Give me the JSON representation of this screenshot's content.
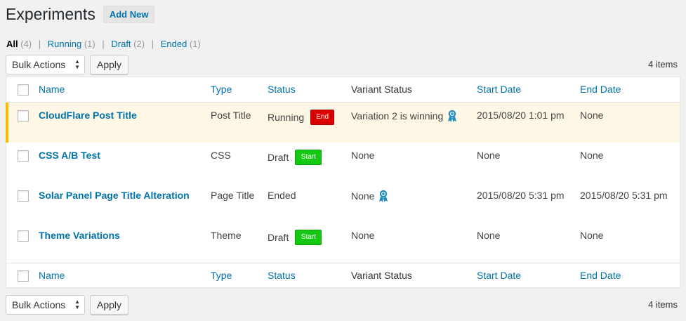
{
  "header": {
    "title": "Experiments",
    "add_new_label": "Add New"
  },
  "filters": [
    {
      "label": "All",
      "count": "(4)",
      "current": true
    },
    {
      "label": "Running",
      "count": "(1)"
    },
    {
      "label": "Draft",
      "count": "(2)"
    },
    {
      "label": "Ended",
      "count": "(1)"
    }
  ],
  "tablenav": {
    "bulk_label": "Bulk Actions",
    "apply_label": "Apply",
    "items_count": "4 items"
  },
  "columns": {
    "name": "Name",
    "type": "Type",
    "status": "Status",
    "variant_status": "Variant Status",
    "start_date": "Start Date",
    "end_date": "End Date"
  },
  "rows": [
    {
      "name": "CloudFlare Post Title",
      "type": "Post Title",
      "status": "Running",
      "action": "End",
      "variant": "Variation 2 is winning",
      "variant_icon": "award-ribbon-icon",
      "start": "2015/08/20 1:01 pm",
      "end": "None"
    },
    {
      "name": "CSS A/B Test",
      "type": "CSS",
      "status": "Draft",
      "action": "Start",
      "variant": "None",
      "start": "None",
      "end": "None"
    },
    {
      "name": "Solar Panel Page Title Alteration",
      "type": "Page Title",
      "status": "Ended",
      "variant": "None",
      "variant_icon": "award-ribbon-icon",
      "start": "2015/08/20 5:31 pm",
      "end": "2015/08/20 5:31 pm"
    },
    {
      "name": "Theme Variations",
      "type": "Theme",
      "status": "Draft",
      "action": "Start",
      "variant": "None",
      "start": "None",
      "end": "None"
    }
  ],
  "colors": {
    "link": "#0073aa",
    "highlight_bg": "#fef7e5",
    "highlight_bar": "#ffb900",
    "end_badge": "#dd0000",
    "start_badge": "#14c814"
  }
}
